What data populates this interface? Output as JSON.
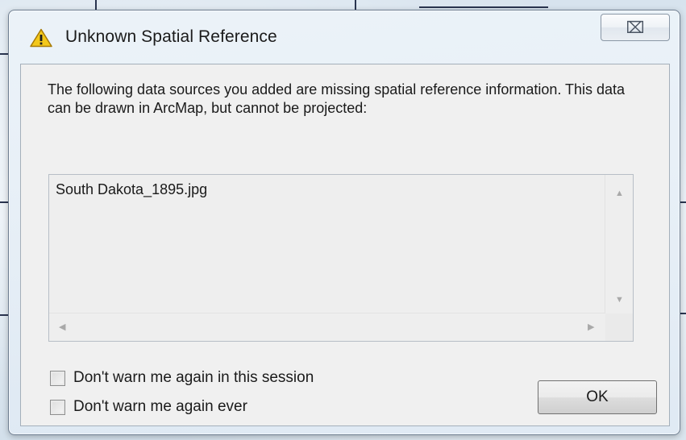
{
  "dialog": {
    "title": "Unknown Spatial Reference",
    "close_glyph": "⌧",
    "message": "The following data sources you added are missing spatial reference information. This data can be drawn in ArcMap, but cannot be projected:",
    "list_items": [
      "South Dakota_1895.jpg"
    ],
    "checkbox_session_label": "Don't warn me again in this session",
    "checkbox_ever_label": "Don't warn me again ever",
    "ok_label": "OK"
  },
  "icons": {
    "title": "warning-icon",
    "close": "close-icon"
  },
  "colors": {
    "warning_fill": "#f3c81b",
    "warning_stroke": "#a77a05"
  }
}
